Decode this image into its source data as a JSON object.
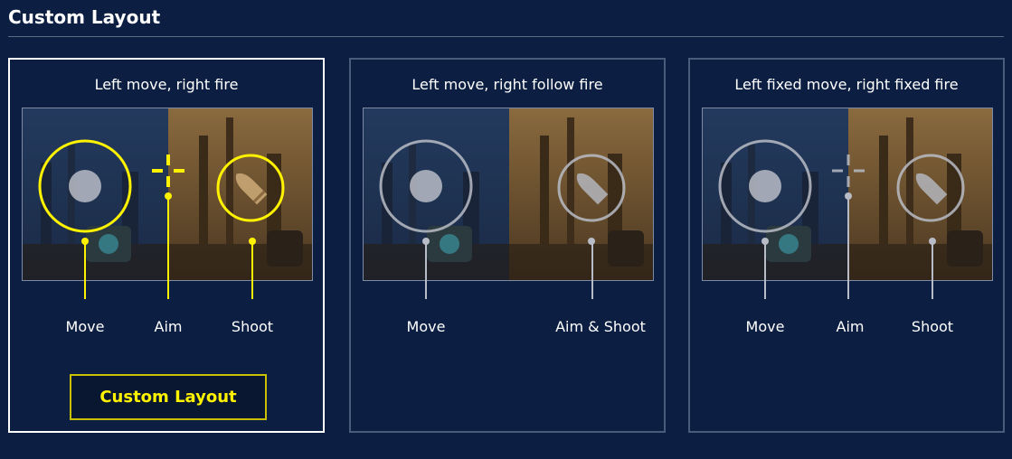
{
  "page": {
    "title": "Custom Layout"
  },
  "colors": {
    "background": "#0c1f42",
    "accent": "#fff200",
    "accent_border": "#c8c000",
    "card_border": "#4a5c7c",
    "selected_border": "#ffffff",
    "inactive_control": "#b8bcc6"
  },
  "cards": [
    {
      "title": "Left move, right fire",
      "selected": true,
      "labels": {
        "move": "Move",
        "aim": "Aim",
        "shoot": "Shoot"
      },
      "button_label": "Custom Layout"
    },
    {
      "title": "Left move, right follow fire",
      "selected": false,
      "labels": {
        "move": "Move",
        "aim_shoot": "Aim & Shoot"
      }
    },
    {
      "title": "Left fixed move, right fixed fire",
      "selected": false,
      "labels": {
        "move": "Move",
        "aim": "Aim",
        "shoot": "Shoot"
      }
    }
  ],
  "icons": {
    "joystick": "joystick-icon",
    "crosshair": "crosshair-icon",
    "bullet": "bullet-icon"
  }
}
